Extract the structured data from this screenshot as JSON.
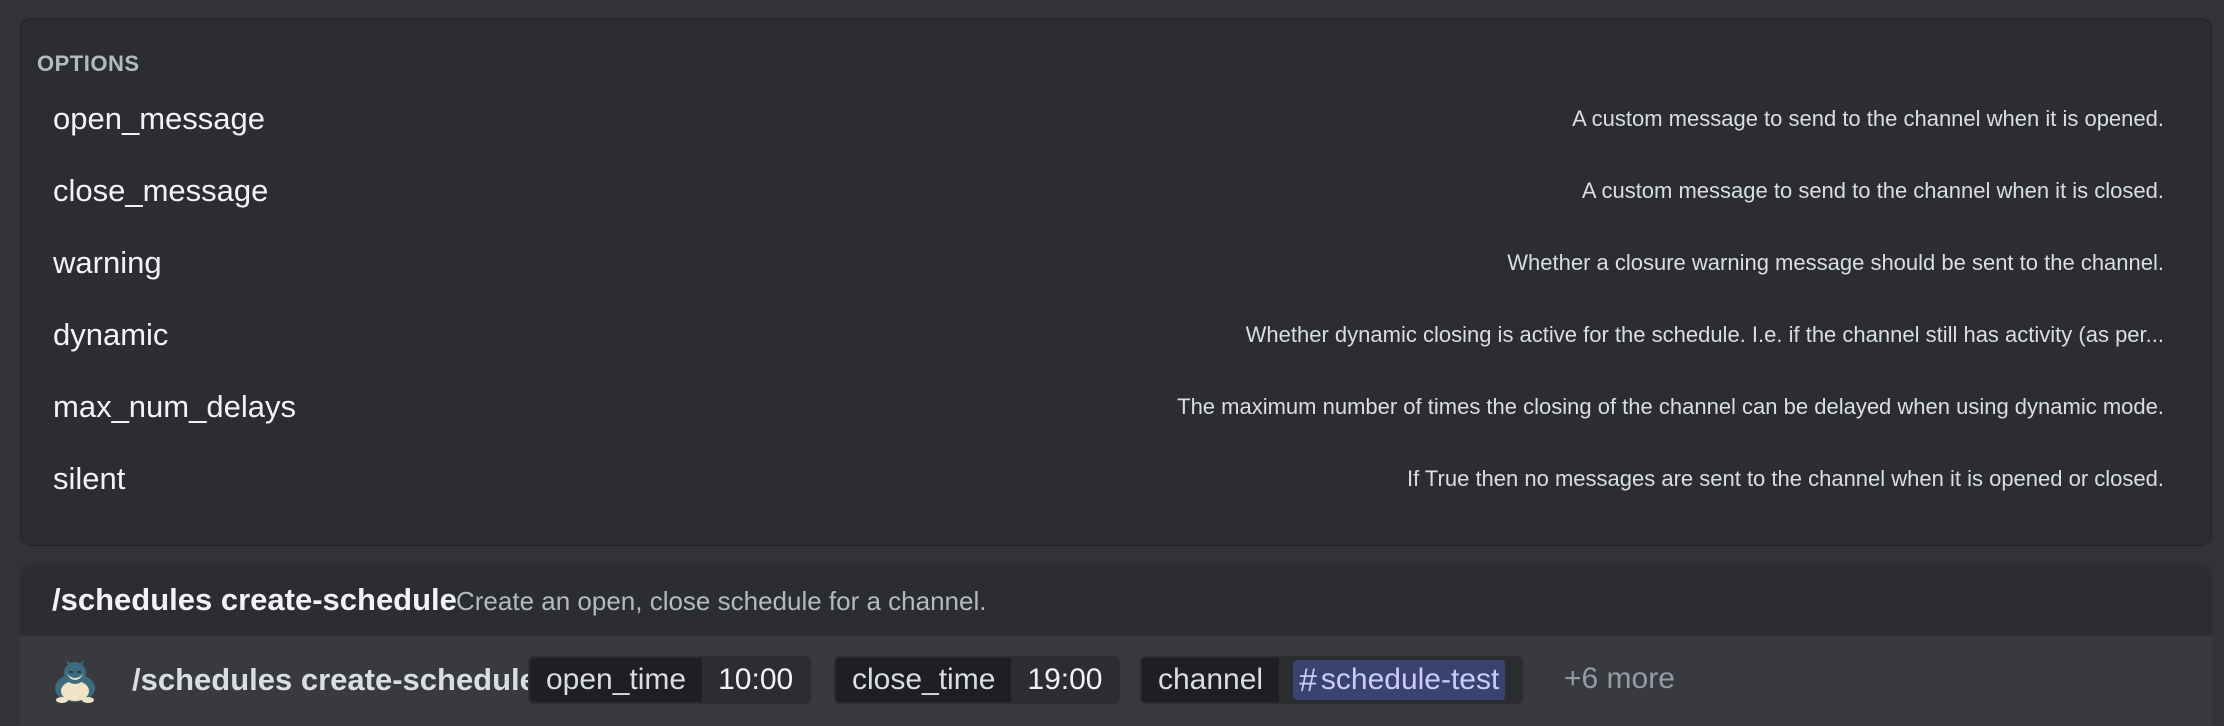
{
  "options_panel": {
    "header": "OPTIONS",
    "items": [
      {
        "name": "open_message",
        "description": "A custom message to send to the channel when it is opened."
      },
      {
        "name": "close_message",
        "description": "A custom message to send to the channel when it is closed."
      },
      {
        "name": "warning",
        "description": "Whether a closure warning message should be sent to the channel."
      },
      {
        "name": "dynamic",
        "description": "Whether dynamic closing is active for the schedule. I.e. if the channel still has activity (as per..."
      },
      {
        "name": "max_num_delays",
        "description": "The maximum number of times the closing of the channel can be delayed when using dynamic mode."
      },
      {
        "name": "silent",
        "description": "If True then no messages are sent to the channel when it is opened or closed."
      }
    ]
  },
  "suggestion": {
    "command": "/schedules create-schedule",
    "description": "Create an open, close schedule for a channel."
  },
  "input": {
    "command": "/schedules create-schedule",
    "params": [
      {
        "key": "open_time",
        "value": "10:00"
      },
      {
        "key": "close_time",
        "value": "19:00"
      },
      {
        "key": "channel",
        "value": "schedule-test",
        "icon": "#"
      }
    ],
    "more": "+6 more"
  },
  "colors": {
    "background": "#313338",
    "panel": "#2b2d31",
    "input_bar": "#383a40",
    "mention_bg": "#3c4270",
    "mention_text": "#c9cdfb"
  }
}
